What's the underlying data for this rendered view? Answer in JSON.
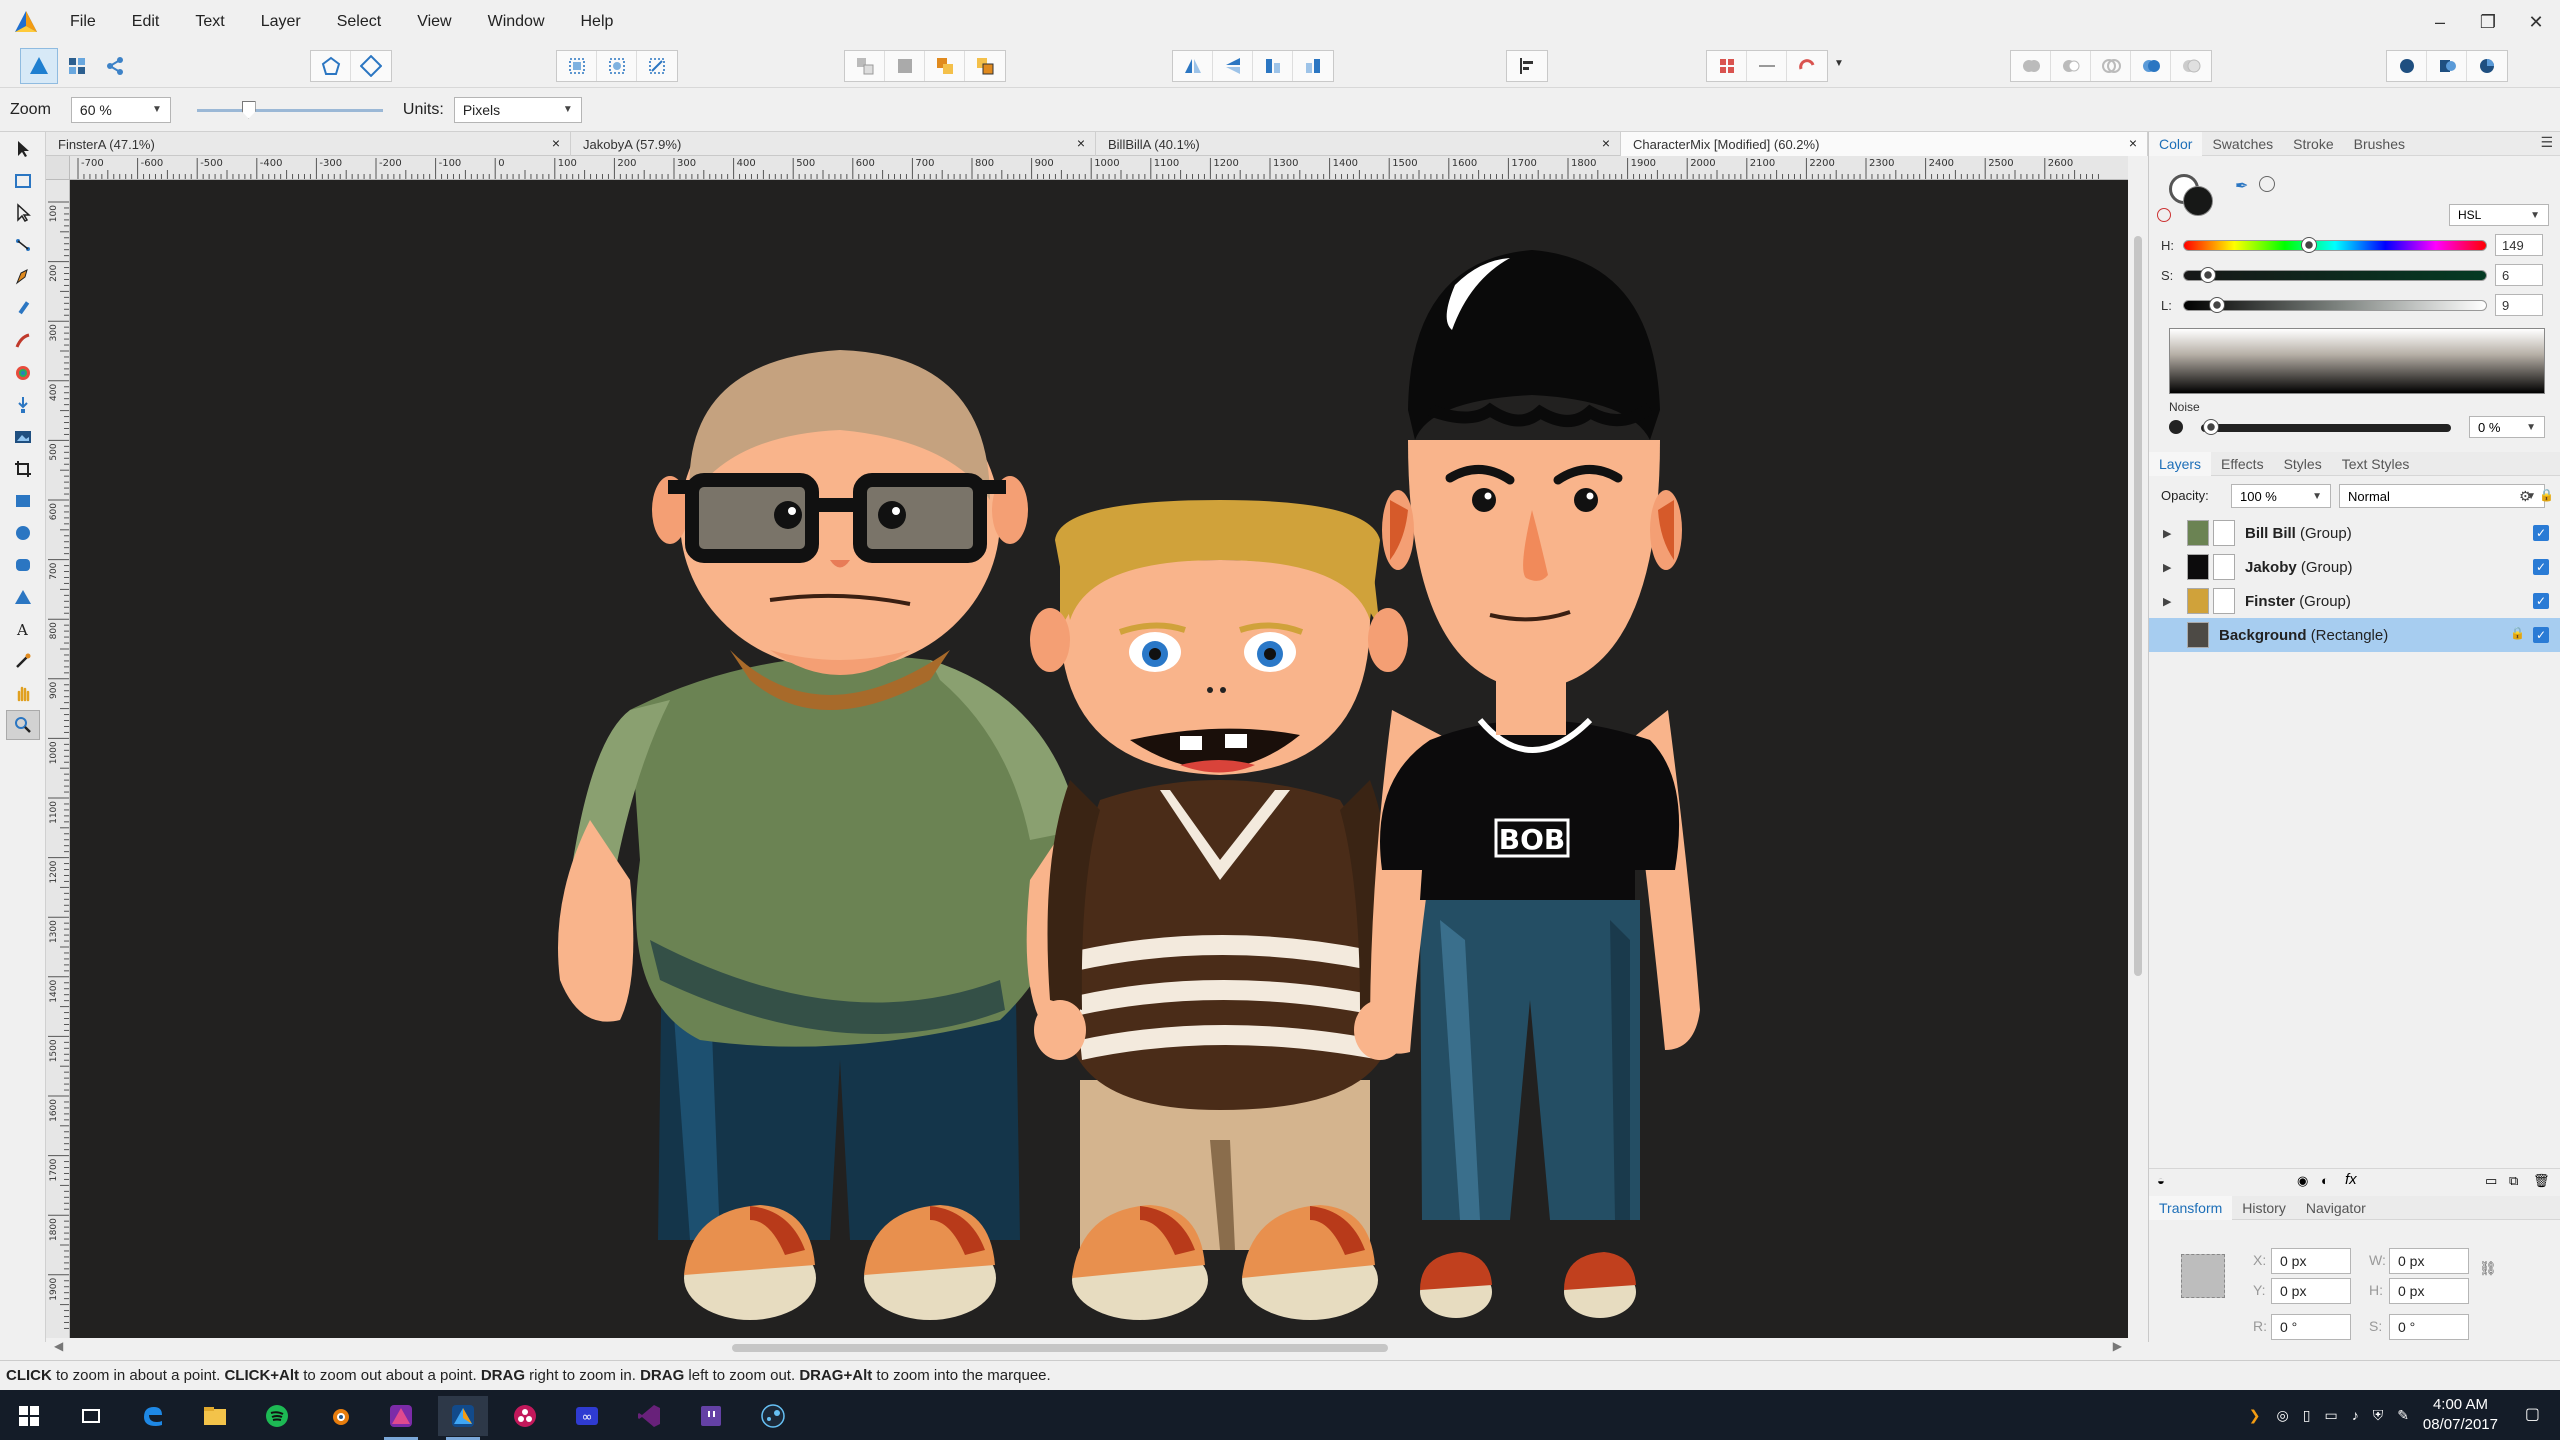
{
  "menu": [
    "File",
    "Edit",
    "Text",
    "Layer",
    "Select",
    "View",
    "Window",
    "Help"
  ],
  "window_controls": {
    "minimize": "–",
    "restore": "❐",
    "close": "✕"
  },
  "context": {
    "zoom_label": "Zoom",
    "zoom_value": "60 %",
    "zoom_slider_fraction": 0.26,
    "units_label": "Units:",
    "units_value": "Pixels"
  },
  "doc_tabs": [
    {
      "label": "FinsterA (47.1%)",
      "active": false
    },
    {
      "label": "JakobyA (57.9%)",
      "active": false
    },
    {
      "label": "BillBillA (40.1%)",
      "active": false
    },
    {
      "label": "CharacterMix [Modified] (60.2%)",
      "active": true
    }
  ],
  "tab_close": "×",
  "ruler_top_labels": [
    "-700",
    "-600",
    "-500",
    "-400",
    "-300",
    "-200",
    "-100",
    "0",
    "100",
    "200",
    "300",
    "400",
    "500",
    "600",
    "700",
    "800",
    "900",
    "1000",
    "1100",
    "1200",
    "1300",
    "1400",
    "1500",
    "1600",
    "1700",
    "1800",
    "1900",
    "2000",
    "2100",
    "2200",
    "2300",
    "2400",
    "2500",
    "2600"
  ],
  "ruler_left_labels": [
    "100",
    "200",
    "300",
    "400",
    "500",
    "600",
    "700",
    "800",
    "900",
    "1000",
    "1100",
    "1200",
    "1300",
    "1400",
    "1500",
    "1600",
    "1700",
    "1800",
    "1900"
  ],
  "status": {
    "k1": "CLICK",
    "t1": " to zoom in about a point. ",
    "k2": "CLICK+Alt",
    "t2": " to zoom out about a point. ",
    "k3": "DRAG",
    "t3": " right to zoom in. ",
    "k4": "DRAG",
    "t4": " left to zoom out. ",
    "k5": "DRAG+Alt",
    "t5": " to zoom into the marquee."
  },
  "color_panel": {
    "tabs": [
      "Color",
      "Swatches",
      "Stroke",
      "Brushes"
    ],
    "model": "HSL",
    "h_label": "H:",
    "h_value": "149",
    "h_fraction": 0.41,
    "s_label": "S:",
    "s_value": "6",
    "s_fraction": 0.06,
    "l_label": "L:",
    "l_value": "9",
    "l_fraction": 0.09,
    "noise_label": "Noise",
    "noise_value": "0 %",
    "current_color": "#171817"
  },
  "layers_panel": {
    "tabs": [
      "Layers",
      "Effects",
      "Styles",
      "Text Styles"
    ],
    "opacity_label": "Opacity:",
    "opacity_value": "100 %",
    "blend_mode": "Normal",
    "layers": [
      {
        "name": "Bill Bill",
        "type": "(Group)",
        "selected": false,
        "expandable": true
      },
      {
        "name": "Jakoby",
        "type": "(Group)",
        "selected": false,
        "expandable": true
      },
      {
        "name": "Finster",
        "type": "(Group)",
        "selected": false,
        "expandable": true
      },
      {
        "name": "Background",
        "type": "(Rectangle)",
        "selected": true,
        "expandable": false
      }
    ]
  },
  "transform_panel": {
    "tabs": [
      "Transform",
      "History",
      "Navigator"
    ],
    "x_label": "X:",
    "x_value": "0 px",
    "y_label": "Y:",
    "y_value": "0 px",
    "w_label": "W:",
    "w_value": "0 px",
    "h_label": "H:",
    "h_value": "0 px",
    "r_label": "R:",
    "r_value": "0 °",
    "s_label": "S:",
    "s_value": "0 °"
  },
  "artwork": {
    "text_on_shirt": "BOB",
    "background_color": "#222120"
  },
  "clock": {
    "time": "4:00 AM",
    "date": "08/07/2017"
  }
}
